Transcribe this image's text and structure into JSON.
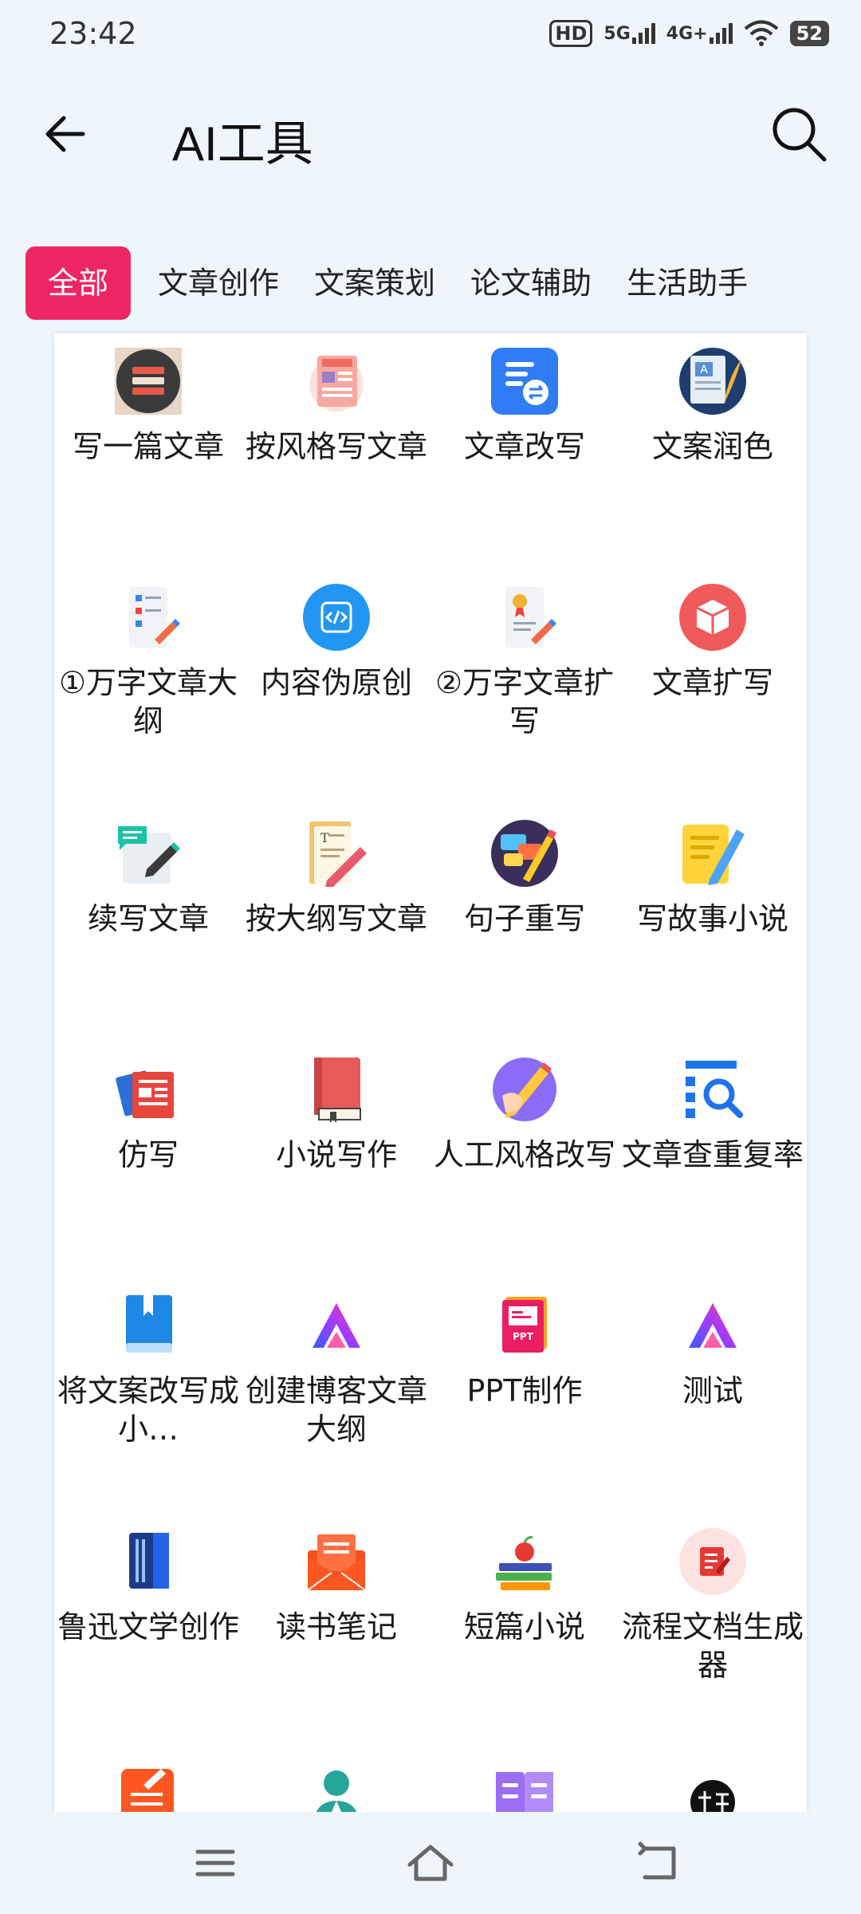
{
  "status_bar": {
    "time": "23:42",
    "hd": "HD",
    "net1": "5G",
    "net2": "4G+",
    "battery": "52"
  },
  "header": {
    "title": "AI工具",
    "back_icon": "back-arrow-icon",
    "search_icon": "search-icon"
  },
  "tabs": [
    {
      "label": "全部",
      "active": true
    },
    {
      "label": "文章创作",
      "active": false
    },
    {
      "label": "文案策划",
      "active": false
    },
    {
      "label": "论文辅助",
      "active": false
    },
    {
      "label": "生活助手",
      "active": false
    }
  ],
  "tools": [
    {
      "label": "写一篇文章",
      "icon": "notebook-stack-icon"
    },
    {
      "label": "按风格写文章",
      "icon": "news-paper-icon"
    },
    {
      "label": "文章改写",
      "icon": "document-swap-icon"
    },
    {
      "label": "文案润色",
      "icon": "document-leaf-icon"
    },
    {
      "label": "①万字文章大纲",
      "icon": "outline-doc-icon"
    },
    {
      "label": "内容伪原创",
      "icon": "code-icon"
    },
    {
      "label": "②万字文章扩写",
      "icon": "certificate-doc-icon"
    },
    {
      "label": "文章扩写",
      "icon": "cube-icon"
    },
    {
      "label": "续写文章",
      "icon": "chat-edit-icon"
    },
    {
      "label": "按大纲写文章",
      "icon": "text-pencil-icon"
    },
    {
      "label": "句子重写",
      "icon": "chat-pencil-icon"
    },
    {
      "label": "写故事小说",
      "icon": "note-pen-icon"
    },
    {
      "label": "仿写",
      "icon": "papers-icon"
    },
    {
      "label": "小说写作",
      "icon": "book-icon"
    },
    {
      "label": "人工风格改写",
      "icon": "hand-pencil-icon"
    },
    {
      "label": "文章查重复率",
      "icon": "doc-search-icon"
    },
    {
      "label": "将文案改写成小…",
      "icon": "bookmark-book-icon"
    },
    {
      "label": "创建博客文章大纲",
      "icon": "triangle-logo-icon"
    },
    {
      "label": "PPT制作",
      "icon": "ppt-icon"
    },
    {
      "label": "测试",
      "icon": "triangle-logo-icon"
    },
    {
      "label": "鲁迅文学创作",
      "icon": "notebook-icon"
    },
    {
      "label": "读书笔记",
      "icon": "envelope-doc-icon"
    },
    {
      "label": "短篇小说",
      "icon": "books-apple-icon"
    },
    {
      "label": "流程文档生成器",
      "icon": "doc-edit-circle-icon"
    },
    {
      "label": "",
      "icon": "edit-doc-icon"
    },
    {
      "label": "",
      "icon": "person-icon"
    },
    {
      "label": "",
      "icon": "open-book-icon"
    },
    {
      "label": "",
      "icon": "char-badge-icon"
    }
  ],
  "nav": {
    "menu_icon": "menu-icon",
    "home_icon": "home-icon",
    "back_icon": "return-icon"
  }
}
